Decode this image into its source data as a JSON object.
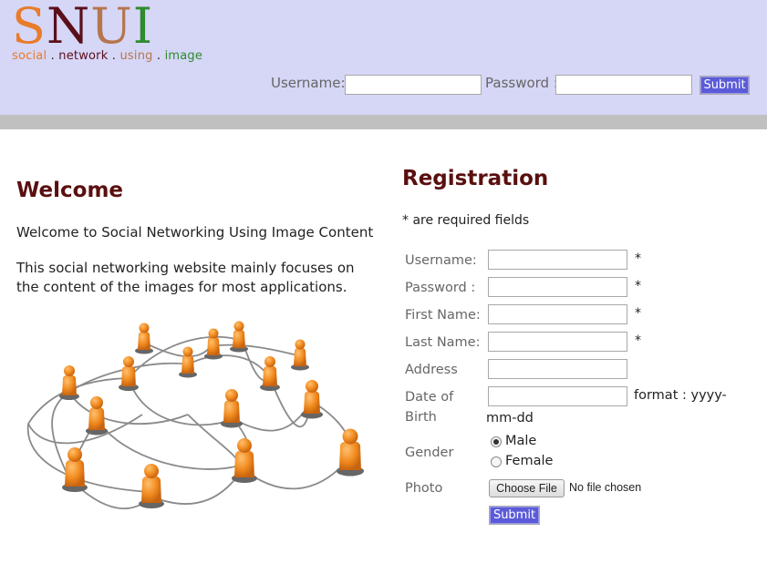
{
  "logo": {
    "letters": [
      {
        "char": "S",
        "color": "#e87c2a"
      },
      {
        "char": "N",
        "color": "#5a0f1a"
      },
      {
        "char": "U",
        "color": "#b5764d"
      },
      {
        "char": "I",
        "color": "#2e8b2e"
      }
    ],
    "tagline": [
      {
        "text": "social",
        "color": "#e87c2a"
      },
      {
        "text": " . ",
        "color": "#222222"
      },
      {
        "text": "network",
        "color": "#5a0f1a"
      },
      {
        "text": " . ",
        "color": "#222222"
      },
      {
        "text": "using",
        "color": "#b5764d"
      },
      {
        "text": " . ",
        "color": "#222222"
      },
      {
        "text": "image",
        "color": "#2e8b2e"
      }
    ]
  },
  "login": {
    "username_label": "Username:",
    "username_value": "",
    "password_label": "Password :",
    "password_value": "",
    "submit_label": "Submit"
  },
  "welcome": {
    "title": "Welcome",
    "intro": "Welcome to Social Networking Using Image Content",
    "body": "This social networking website mainly focuses on the content of the images for most applications."
  },
  "registration": {
    "title": "Registration",
    "required_note": "* are required fields",
    "fields": {
      "username": {
        "label": "Username:",
        "value": "",
        "required": "*"
      },
      "password": {
        "label": "Password :",
        "value": "",
        "required": "*"
      },
      "first_name": {
        "label": "First Name:",
        "value": "",
        "required": "*"
      },
      "last_name": {
        "label": "Last Name:",
        "value": "",
        "required": "*"
      },
      "address": {
        "label": "Address",
        "value": ""
      },
      "dob": {
        "label_line1": "Date of",
        "label_line2": "Birth",
        "value": "",
        "hint_line1": "format : yyyy-",
        "hint_line2": "mm-dd"
      }
    },
    "gender": {
      "label": "Gender",
      "options": [
        "Male",
        "Female"
      ],
      "selected": "Male"
    },
    "photo": {
      "label": "Photo",
      "choose_button": "Choose File",
      "status": "No file chosen"
    },
    "submit_label": "Submit"
  },
  "colors": {
    "header_bg": "#d6d6f7",
    "divider": "#c0c0c0",
    "heading": "#5a0f0f",
    "button": "#5b5bd9",
    "figure": "#f08a1e"
  }
}
